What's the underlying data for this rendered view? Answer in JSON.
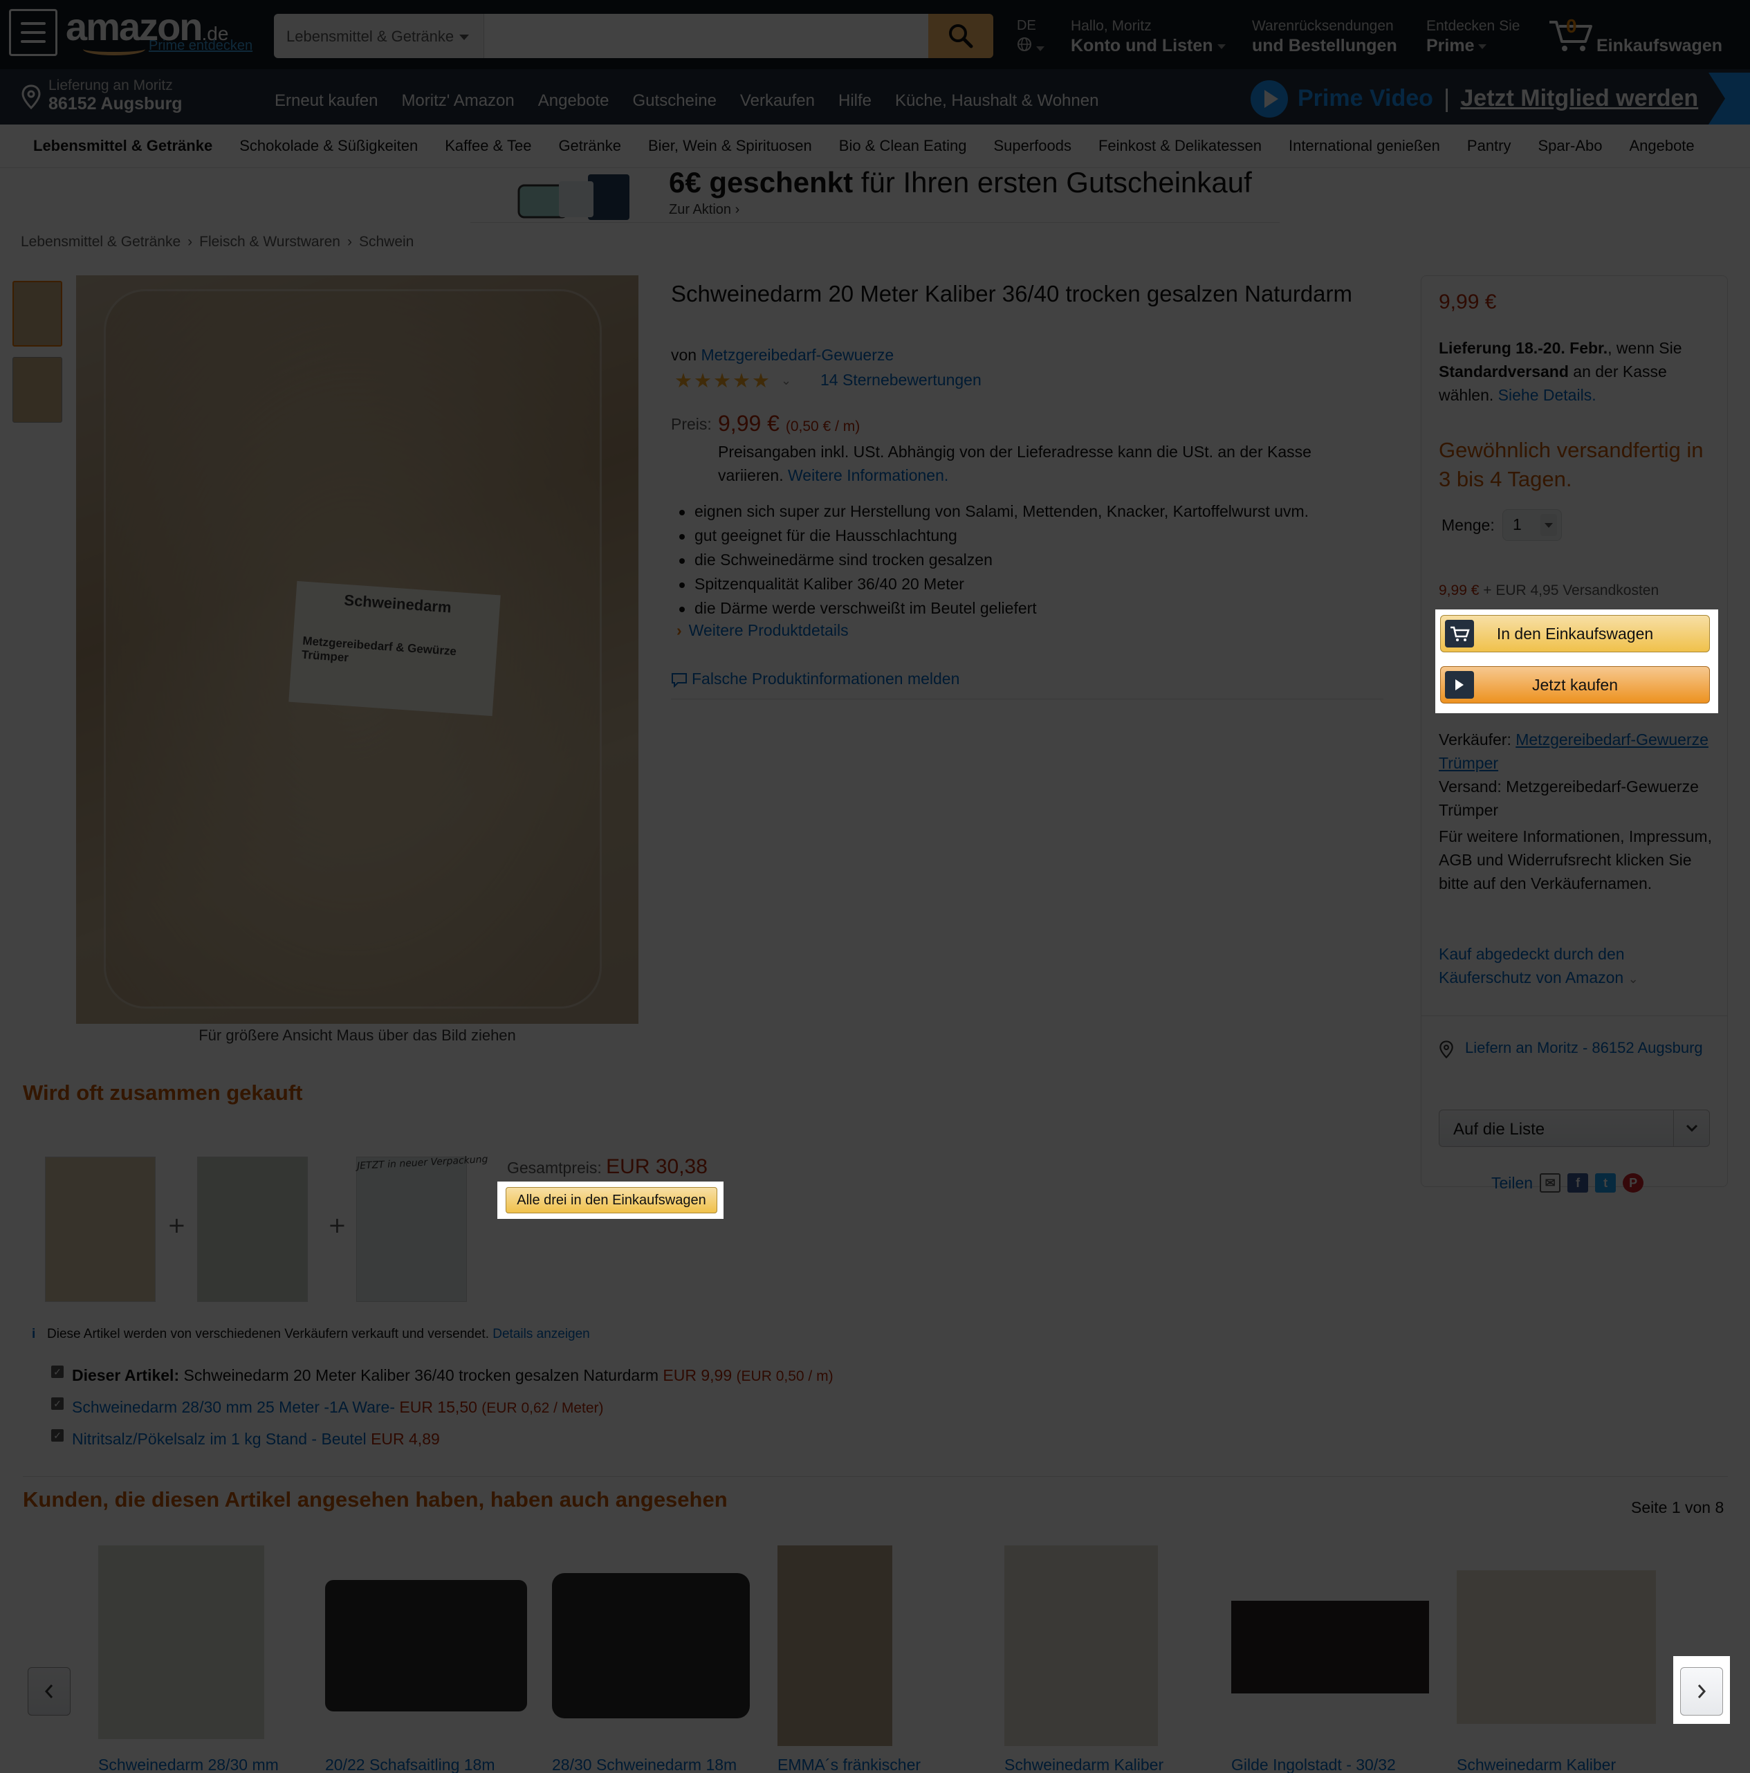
{
  "header": {
    "logo_text": "amazon",
    "logo_tld": ".de",
    "prime_link": "Prime entdecken",
    "search_category": "Lebensmittel & Getränke",
    "search_placeholder": "",
    "language": "DE",
    "account_greeting": "Hallo, Moritz",
    "account_label": "Konto und Listen",
    "returns_line1": "Warenrücksendungen",
    "returns_line2": "und Bestellungen",
    "prime_line1": "Entdecken Sie",
    "prime_line2": "Prime",
    "cart_count": "0",
    "cart_label": "Einkaufswagen"
  },
  "subnav": {
    "deliver_line1": "Lieferung an Moritz",
    "deliver_line2": "86152 Augsburg",
    "links": [
      "Erneut kaufen",
      "Moritz' Amazon",
      "Angebote",
      "Gutscheine",
      "Verkaufen",
      "Hilfe",
      "Küche, Haushalt & Wohnen"
    ],
    "prime_video": "Prime Video",
    "prime_video_sep": "|",
    "prime_video_cta": "Jetzt Mitglied werden"
  },
  "category_bar": [
    "Lebensmittel & Getränke",
    "Schokolade & Süßigkeiten",
    "Kaffee & Tee",
    "Getränke",
    "Bier, Wein & Spirituosen",
    "Bio & Clean Eating",
    "Superfoods",
    "Feinkost & Delikatessen",
    "International genießen",
    "Pantry",
    "Spar-Abo",
    "Angebote"
  ],
  "promo": {
    "amount": "6€",
    "bold": "geschenkt",
    "rest": " für Ihren ersten Gutscheinkauf",
    "sub": "Zur Aktion ›"
  },
  "breadcrumb": [
    "Lebensmittel & Getränke",
    "Fleisch & Wurstwaren",
    "Schwein"
  ],
  "product": {
    "title": "Schweinedarm 20 Meter Kaliber 36/40 trocken gesalzen Naturdarm",
    "by_prefix": "von",
    "brand": "Metzgereibedarf-Gewuerze",
    "rating_stars": 5,
    "ratings_count": "14 Sternebewertungen",
    "price_label": "Preis:",
    "price": "9,99 €",
    "price_unit": "(0,50 € / m)",
    "tax_note": "Preisangaben inkl. USt. Abhängig von der Lieferadresse kann die USt. an der Kasse variieren.",
    "tax_link": "Weitere Informationen.",
    "bullets": [
      "eignen sich super zur Herstellung von Salami, Mettenden, Knacker, Kartoffelwurst uvm.",
      "gut geeignet für die Hausschlachtung",
      "die Schweinedärme sind trocken gesalzen",
      "Spitzenqualität Kaliber 36/40 20 Meter",
      "die Därme werde verschweißt im Beutel geliefert"
    ],
    "more_details": "Weitere Produktdetails",
    "report": "Falsche Produktinformationen melden",
    "hover_hint": "Für größere Ansicht Maus über das Bild ziehen",
    "image_label_title": "Schweinedarm",
    "image_label_text": "Metzgereibedarf & Gewürze Trümper"
  },
  "buybox": {
    "price": "9,99 €",
    "delivery_bold1": "Lieferung 18.-20. Febr.",
    "delivery_mid": ", wenn Sie",
    "delivery_bold2": "Standardversand",
    "delivery_end": " an der Kasse wählen.",
    "delivery_link": "Siehe Details.",
    "stock": "Gewöhnlich versandfertig in 3 bis 4 Tagen.",
    "qty_label": "Menge:",
    "qty_value": "1",
    "ship_price": "9,99 €",
    "ship_rest": " + EUR 4,95 Versandkosten",
    "cart_button": "In den Einkaufswagen",
    "buy_button": "Jetzt kaufen",
    "seller_label": "Verkäufer:",
    "seller_name": "Metzgereibedarf-Gewuerze Trümper",
    "shipper": "Versand: Metzgereibedarf-Gewuerze Trümper",
    "info": "Für weitere Informationen, Impressum, AGB und Widerrufsrecht klicken Sie bitte auf den Verkäufernamen.",
    "protect": "Kauf abgedeckt durch den Käuferschutz von Amazon",
    "deliver_to": "Liefern an Moritz - 86152 Augsburg",
    "list_button": "Auf die Liste",
    "share": "Teilen"
  },
  "fbt": {
    "title": "Wird oft zusammen gekauft",
    "total_label": "Gesamtpreis:",
    "total": "EUR 30,38",
    "button": "Alle drei in den Einkaufswagen",
    "note": "Diese Artikel werden von verschiedenen Verkäufern verkauft und versendet.",
    "note_link": "Details anzeigen",
    "image_caption": "JETZT in neuer Verpackung",
    "items": [
      {
        "prefix": "Dieser Artikel:",
        "name": "Schweinedarm 20 Meter Kaliber 36/40 trocken gesalzen Naturdarm",
        "price": "EUR 9,99",
        "unit": "(EUR 0,50  / m)"
      },
      {
        "prefix": "",
        "name": "Schweinedarm 28/30 mm 25 Meter -1A Ware-",
        "price": "EUR 15,50",
        "unit": "(EUR 0,62  / Meter)"
      },
      {
        "prefix": "",
        "name": "Nitritsalz/Pökelsalz im 1 kg Stand - Beutel",
        "price": "EUR 4,89",
        "unit": ""
      }
    ]
  },
  "also_viewed": {
    "title": "Kunden, die diesen Artikel angesehen haben, haben auch angesehen",
    "page": "Seite 1 von 8",
    "items": [
      "Schweinedarm 28/30 mm",
      "20/22 Schafsaitling 18m",
      "28/30 Schweinedarm 18m",
      "EMMA´s fränkischer",
      "Schweinedarm Kaliber",
      "Gilde Ingolstadt - 30/32",
      "Schweinedarm Kaliber"
    ]
  }
}
